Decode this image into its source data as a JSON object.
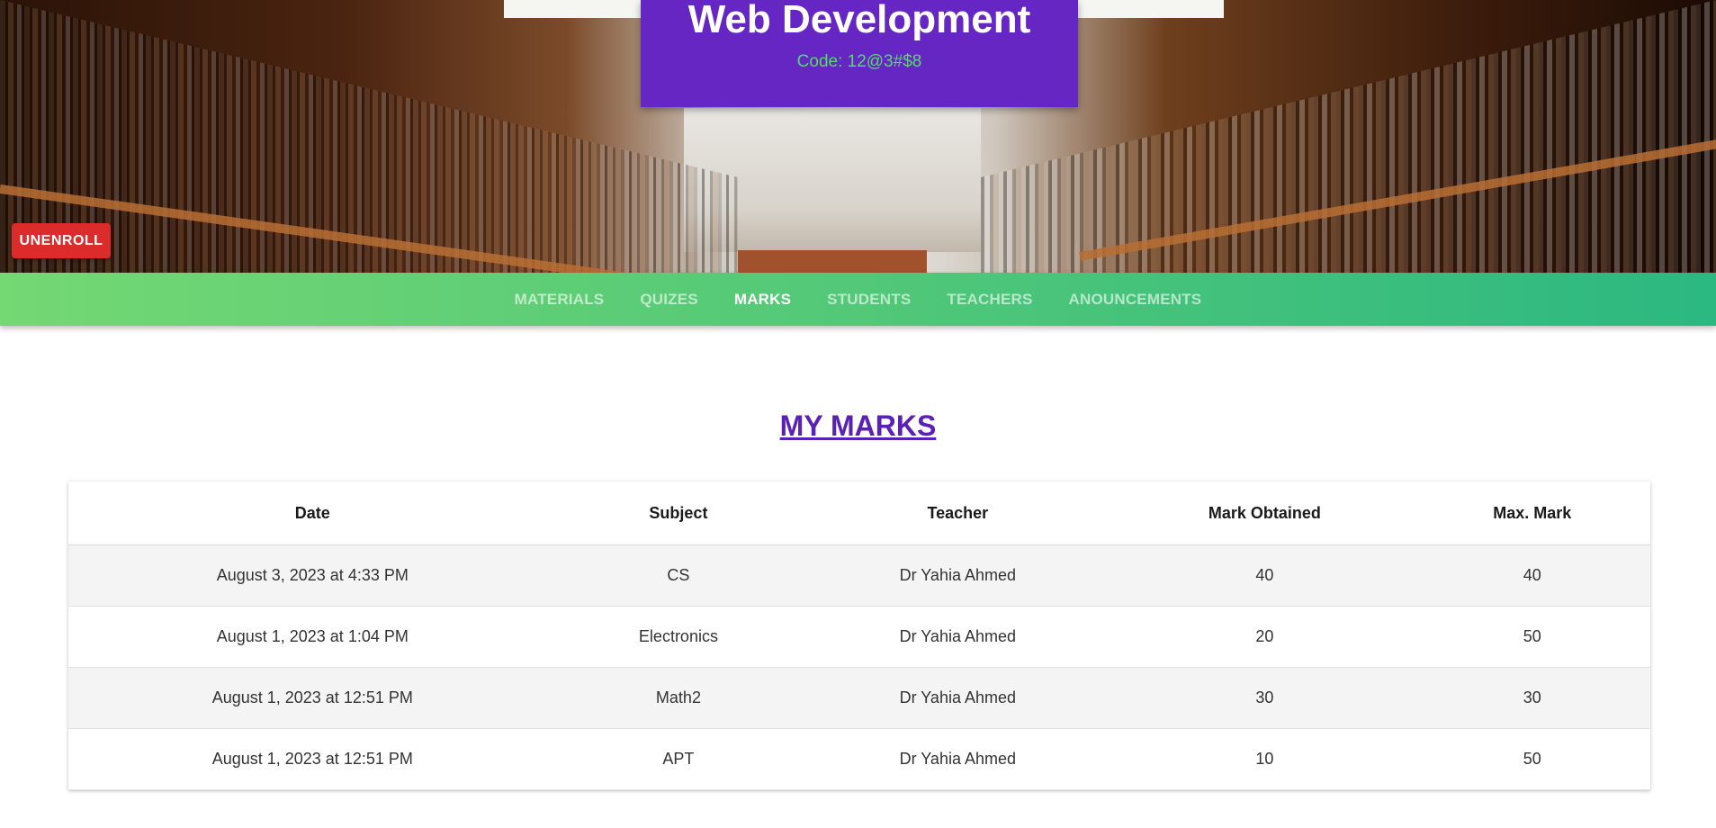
{
  "course": {
    "title": "Web Development",
    "code": "Code: 12@3#$8"
  },
  "actions": {
    "unenroll_label": "UNENROLL"
  },
  "tabs": [
    {
      "label": "MATERIALS",
      "active": false
    },
    {
      "label": "QUIZES",
      "active": false
    },
    {
      "label": "MARKS",
      "active": true
    },
    {
      "label": "STUDENTS",
      "active": false
    },
    {
      "label": "TEACHERS",
      "active": false
    },
    {
      "label": "ANOUNCEMENTS",
      "active": false
    }
  ],
  "marks": {
    "heading": "MY MARKS",
    "columns": [
      "Date",
      "Subject",
      "Teacher",
      "Mark Obtained",
      "Max. Mark"
    ],
    "rows": [
      [
        "August 3, 2023 at 4:33 PM",
        "CS",
        "Dr Yahia Ahmed",
        "40",
        "40"
      ],
      [
        "August 1, 2023 at 1:04 PM",
        "Electronics",
        "Dr Yahia Ahmed",
        "20",
        "50"
      ],
      [
        "August 1, 2023 at 12:51 PM",
        "Math2",
        "Dr Yahia Ahmed",
        "30",
        "30"
      ],
      [
        "August 1, 2023 at 12:51 PM",
        "APT",
        "Dr Yahia Ahmed",
        "10",
        "50"
      ]
    ]
  },
  "colors": {
    "title_card_bg": "#6626c4",
    "code_text": "#57d86a",
    "unenroll_bg": "#dc2b2b",
    "tabbar_start": "#74d873",
    "tabbar_end": "#2cb881",
    "heading_text": "#5b21b6"
  }
}
